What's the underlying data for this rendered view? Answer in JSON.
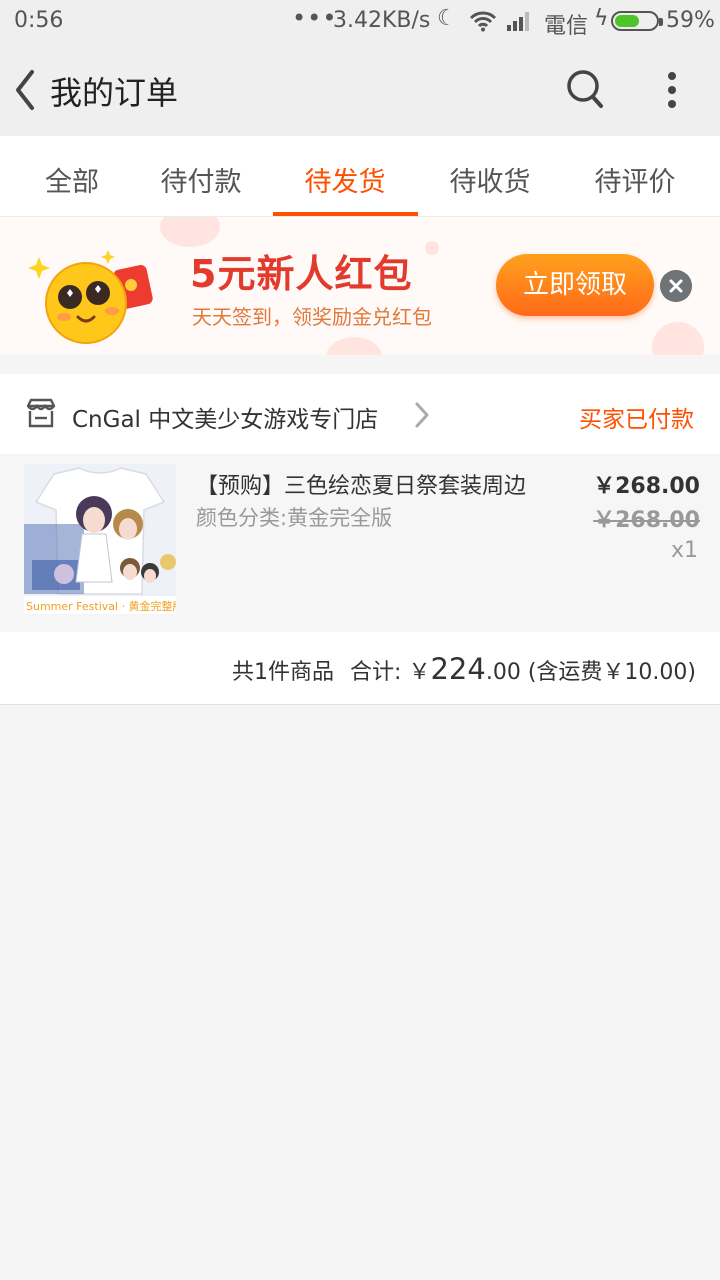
{
  "status_bar": {
    "time": "0:56",
    "dots": "•••",
    "speed": "3.42KB/s",
    "carrier": "電信",
    "battery_percent": "59%",
    "battery_level": 0.59
  },
  "header": {
    "title": "我的订单",
    "icons": [
      "back-icon",
      "search-icon",
      "more-icon"
    ]
  },
  "tabs": [
    {
      "label": "全部"
    },
    {
      "label": "待付款"
    },
    {
      "label": "待发货",
      "active": true
    },
    {
      "label": "待收货"
    },
    {
      "label": "待评价"
    }
  ],
  "banner": {
    "title": "5元新人红包",
    "subtitle": "天天签到，领奖励金兑红包",
    "button_label": "立即领取"
  },
  "order": {
    "store_name": "CnGal 中文美少女游戏专门店",
    "status": "买家已付款",
    "item": {
      "title": "【预购】三色绘恋夏日祭套装周边",
      "sku": "颜色分类:黄金完全版",
      "price": "￥268.00",
      "original_price": "￥268.00",
      "quantity": "x1",
      "image_caption": "Summer Festival · 黄金完整版"
    },
    "summary": {
      "count_text": "共1件商品",
      "total_label": "合计:",
      "currency": "￥",
      "total_int": "224",
      "total_dec": ".00",
      "shipping_text": "(含运费￥10.00)"
    }
  },
  "colors": {
    "accent": "#ff5000",
    "banner_title": "#e23a2c",
    "battery": "#4cc42a"
  }
}
